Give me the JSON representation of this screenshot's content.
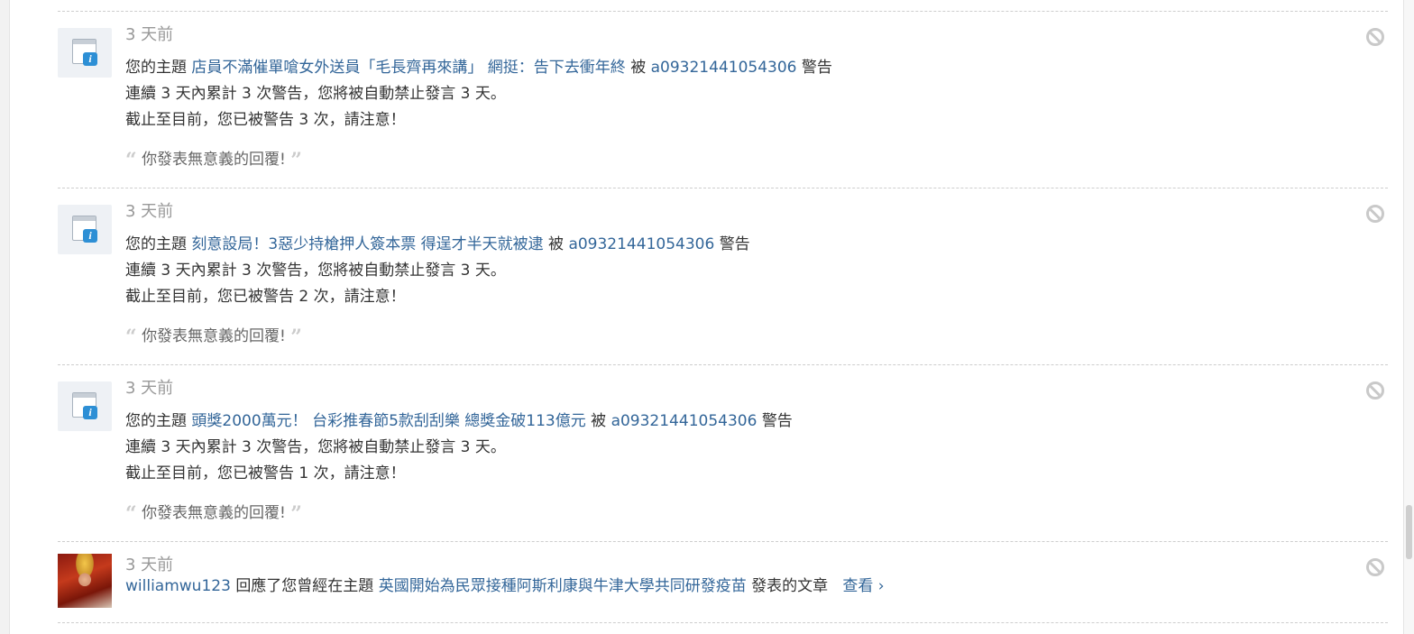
{
  "warnings": [
    {
      "time": "3 天前",
      "prefix": "您的主題",
      "topic": "店員不滿催單嗆女外送員「毛長齊再來講」 網挺：告下去衝年終",
      "by": "被",
      "user": "a09321441054306",
      "suffix": "警告",
      "line2": "連續 3 天內累計 3 次警告，您將被自動禁止發言 3 天。",
      "line3": "截止至目前，您已被警告 3 次，請注意！",
      "reason": "你發表無意義的回覆!"
    },
    {
      "time": "3 天前",
      "prefix": "您的主題",
      "topic": "刻意設局！3惡少持槍押人簽本票 得逞才半天就被逮",
      "by": "被",
      "user": "a09321441054306",
      "suffix": "警告",
      "line2": "連續 3 天內累計 3 次警告，您將被自動禁止發言 3 天。",
      "line3": "截止至目前，您已被警告 2 次，請注意！",
      "reason": "你發表無意義的回覆!"
    },
    {
      "time": "3 天前",
      "prefix": "您的主題",
      "topic": "頭獎2000萬元！ 台彩推春節5款刮刮樂 總獎金破113億元",
      "by": "被",
      "user": "a09321441054306",
      "suffix": "警告",
      "line2": "連續 3 天內累計 3 次警告，您將被自動禁止發言 3 天。",
      "line3": "截止至目前，您已被警告 1 次，請注意！",
      "reason": "你發表無意義的回覆!"
    }
  ],
  "reply": {
    "time": "3 天前",
    "user": "williamwu123",
    "text1": "回應了您曾經在主題",
    "topic": "英國開始為民眾接種阿斯利康與牛津大學共同研發疫苗",
    "text2": "發表的文章",
    "view_label": "查看 ›"
  },
  "quote_open": "“",
  "quote_close": "”",
  "colors": {
    "link": "#336699",
    "time": "#999999",
    "divider": "#cdcdcd"
  },
  "icons": {
    "system": "system-notice-icon",
    "delete": "block-icon",
    "avatar": "user-avatar"
  }
}
